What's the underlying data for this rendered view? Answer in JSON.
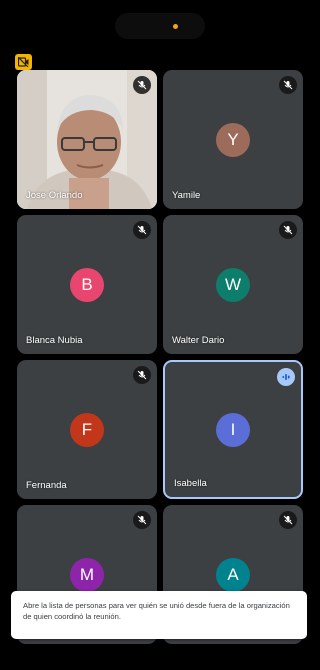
{
  "participants": [
    {
      "name": "Jose Orlando",
      "initial": "",
      "avatar_color": "",
      "mic": "muted",
      "video": true
    },
    {
      "name": "Yamile",
      "initial": "Y",
      "avatar_color": "#9c6b5a",
      "mic": "muted",
      "video": false
    },
    {
      "name": "Blanca Nubia",
      "initial": "B",
      "avatar_color": "#e8466e",
      "mic": "muted",
      "video": false
    },
    {
      "name": "Walter Dario",
      "initial": "W",
      "avatar_color": "#0d7d6c",
      "mic": "muted",
      "video": false
    },
    {
      "name": "Fernanda",
      "initial": "F",
      "avatar_color": "#c2371a",
      "mic": "muted",
      "video": false
    },
    {
      "name": "Isabella",
      "initial": "I",
      "avatar_color": "#5b6dd6",
      "mic": "speaking",
      "video": false
    },
    {
      "name": "",
      "initial": "M",
      "avatar_color": "#8e24aa",
      "mic": "muted",
      "video": false
    },
    {
      "name": "",
      "initial": "A",
      "avatar_color": "#00838f",
      "mic": "muted",
      "video": false
    }
  ],
  "toast": {
    "text": "Abre la lista de personas para ver quién se unió desde fuera de la organización de quien coordinó la reunión."
  },
  "icons": {
    "recording": "recording-icon",
    "muted": "mic-off-icon",
    "speaking": "audio-wave-icon"
  }
}
